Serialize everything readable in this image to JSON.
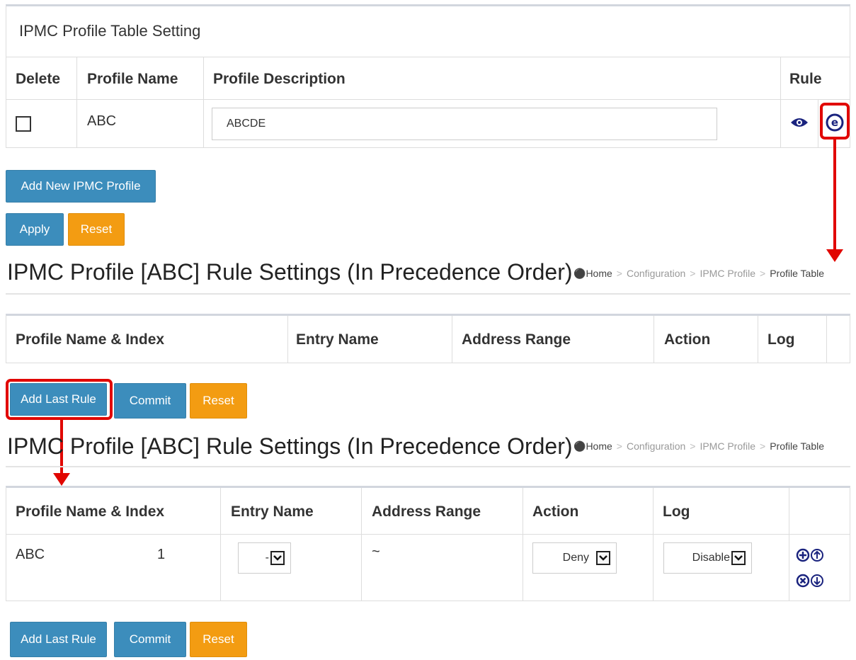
{
  "profile_table": {
    "title": "IPMC Profile Table Setting",
    "columns": {
      "delete": "Delete",
      "profile_name": "Profile Name",
      "profile_description": "Profile Description",
      "rule": "Rule"
    },
    "row": {
      "profile_name": "ABC",
      "description": "ABCDE"
    },
    "add_button": "Add New IPMC Profile",
    "apply_button": "Apply",
    "reset_button": "Reset"
  },
  "rule_settings_1": {
    "title": "IPMC Profile [ABC] Rule Settings (In Precedence Order)",
    "breadcrumb": [
      "Home",
      "Configuration",
      "IPMC Profile",
      "Profile Table"
    ],
    "columns": {
      "profile_name_index": "Profile Name & Index",
      "entry_name": "Entry Name",
      "address_range": "Address Range",
      "action": "Action",
      "log": "Log"
    },
    "add_last_rule": "Add Last Rule",
    "commit": "Commit",
    "reset": "Reset"
  },
  "rule_settings_2": {
    "title": "IPMC Profile [ABC] Rule Settings (In Precedence Order)",
    "breadcrumb": [
      "Home",
      "Configuration",
      "IPMC Profile",
      "Profile Table"
    ],
    "columns": {
      "profile_name_index": "Profile Name & Index",
      "entry_name": "Entry Name",
      "address_range": "Address Range",
      "action": "Action",
      "log": "Log"
    },
    "row": {
      "profile_name": "ABC",
      "index": "1",
      "entry_name": "-",
      "address_range": "~",
      "action": "Deny",
      "log": "Disable"
    },
    "add_last_rule": "Add Last Rule",
    "commit": "Commit",
    "reset": "Reset"
  },
  "icons": {
    "view": "eye-icon",
    "edit": "edit-e-icon",
    "home": "home-icon",
    "insert": "plus-circle-icon",
    "move_up": "arrow-up-circle-icon",
    "delete": "x-circle-icon",
    "move_down": "arrow-down-circle-icon"
  },
  "colors": {
    "primary": "#3c8dbc",
    "warning": "#f39c12",
    "annotation": "#e10600",
    "icon": "#1a237e"
  }
}
